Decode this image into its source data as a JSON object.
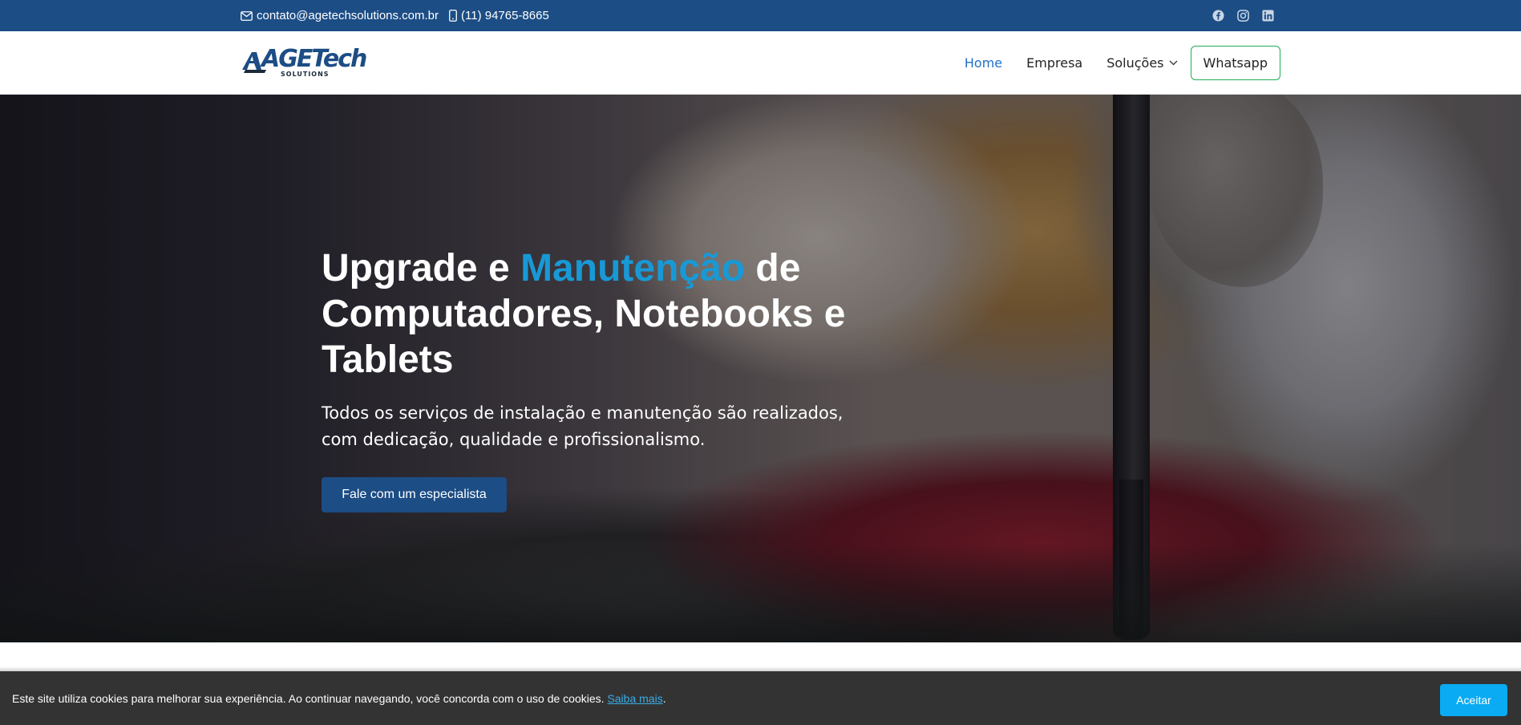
{
  "topbar": {
    "email": "contato@agetechsolutions.com.br",
    "phone": "(11) 94765-8665",
    "social_icons": [
      "facebook-icon",
      "instagram-icon",
      "linkedin-icon"
    ]
  },
  "header": {
    "logo_text": "AGETech",
    "logo_sub": "SOLUTIONS",
    "nav": [
      {
        "label": "Home",
        "active": true
      },
      {
        "label": "Empresa",
        "active": false
      },
      {
        "label": "Soluções",
        "active": false,
        "dropdown": true
      }
    ],
    "whatsapp_label": "Whatsapp"
  },
  "hero": {
    "title_part1": "Upgrade e ",
    "title_highlight": "Manutenção",
    "title_part2": " de Computadores, Notebooks e Tablets",
    "subtitle": "Todos os serviços de instalação e manutenção são realizados, com dedicação, qualidade e profissionalismo.",
    "cta_label": "Fale com um especialista"
  },
  "cookie": {
    "message": "Este site utiliza cookies para melhorar sua experiência. Ao continuar navegando, você concorda com o uso de cookies. ",
    "link_label": "Saiba mais",
    "suffix": ".",
    "accept_label": "Aceitar"
  },
  "colors": {
    "brand_blue": "#1c4d85",
    "highlight": "#1899d6",
    "active_nav": "#1f6fc8",
    "whatsapp_border": "#1fae55",
    "accept_button": "#0aabf2",
    "cookie_bg": "#333333"
  }
}
